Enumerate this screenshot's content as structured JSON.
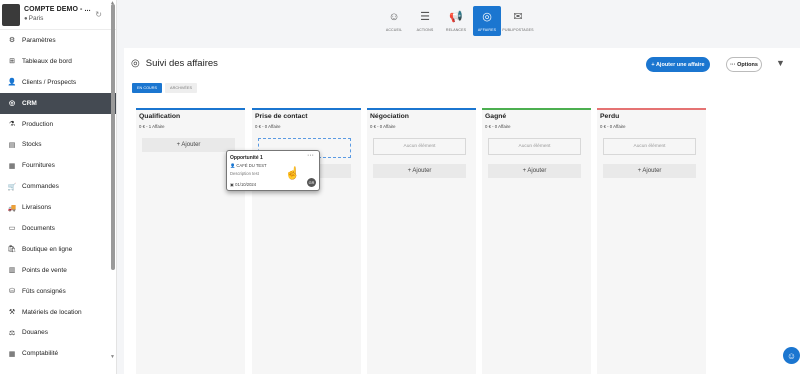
{
  "company": {
    "name": "COMPTE DEMO - ...",
    "location": "Paris"
  },
  "sidebar": {
    "items": [
      {
        "label": "Paramètres",
        "icon": "gear-icon",
        "glyph": "⚙"
      },
      {
        "label": "Tableaux de bord",
        "icon": "dashboard-icon",
        "glyph": "⊞"
      },
      {
        "label": "Clients / Prospects",
        "icon": "user-icon",
        "glyph": "👤"
      },
      {
        "label": "CRM",
        "icon": "crm-icon",
        "glyph": "◎",
        "active": true
      },
      {
        "label": "Production",
        "icon": "production-icon",
        "glyph": "⚗"
      },
      {
        "label": "Stocks",
        "icon": "stocks-icon",
        "glyph": "▤"
      },
      {
        "label": "Fournitures",
        "icon": "supplies-icon",
        "glyph": "▦"
      },
      {
        "label": "Commandes",
        "icon": "cart-icon",
        "glyph": "🛒"
      },
      {
        "label": "Livraisons",
        "icon": "truck-icon",
        "glyph": "🚚"
      },
      {
        "label": "Documents",
        "icon": "document-icon",
        "glyph": "▭"
      },
      {
        "label": "Boutique en ligne",
        "icon": "shop-icon",
        "glyph": "🛍"
      },
      {
        "label": "Points de vente",
        "icon": "store-icon",
        "glyph": "▥"
      },
      {
        "label": "Fûts consignés",
        "icon": "barrel-icon",
        "glyph": "⛁"
      },
      {
        "label": "Matériels de location",
        "icon": "rental-icon",
        "glyph": "⚒"
      },
      {
        "label": "Douanes",
        "icon": "customs-icon",
        "glyph": "⚖"
      },
      {
        "label": "Comptabilité",
        "icon": "accounting-icon",
        "glyph": "▦"
      }
    ]
  },
  "topnav": [
    {
      "label": "ACCUEIL",
      "icon": "home-icon",
      "glyph": "☺"
    },
    {
      "label": "ACTIONS",
      "icon": "list-icon",
      "glyph": "☰"
    },
    {
      "label": "RELANCES",
      "icon": "megaphone-icon",
      "glyph": "📢"
    },
    {
      "label": "AFFAIRES",
      "icon": "deals-icon",
      "glyph": "◎",
      "active": true
    },
    {
      "label": "PUBLIPOSTAGES",
      "icon": "mail-icon",
      "glyph": "✉"
    }
  ],
  "page": {
    "title": "Suivi des affaires",
    "add_button": "+ Ajouter une affaire",
    "options_button": "··· Options",
    "tabs": [
      "EN COURS",
      "ARCHIVÉES"
    ]
  },
  "columns": [
    {
      "title": "Qualification",
      "subtitle": "0 € - 1 Affaire",
      "color": "#1b76d0",
      "empty_label": "",
      "add_label": "+ Ajouter"
    },
    {
      "title": "Prise de contact",
      "subtitle": "0 € - 0 Affaire",
      "color": "#1b76d0",
      "empty_label": "",
      "add_label": "+ Ajouter"
    },
    {
      "title": "Négociation",
      "subtitle": "0 € - 0 Affaire",
      "color": "#1b76d0",
      "empty_label": "Aucun élément",
      "add_label": "+ Ajouter"
    },
    {
      "title": "Gagné",
      "subtitle": "0 € - 0 Affaire",
      "color": "#4caf50",
      "empty_label": "Aucun élément",
      "add_label": "+ Ajouter"
    },
    {
      "title": "Perdu",
      "subtitle": "0 € - 0 Affaire",
      "color": "#e57373",
      "empty_label": "Aucun élément",
      "add_label": "+ Ajouter"
    }
  ],
  "card": {
    "title": "Opportunité 1",
    "client": "CAFÉ DU TEST",
    "description": "Description test",
    "date": "01/10/2024",
    "more": "···",
    "avatar": "GR"
  }
}
